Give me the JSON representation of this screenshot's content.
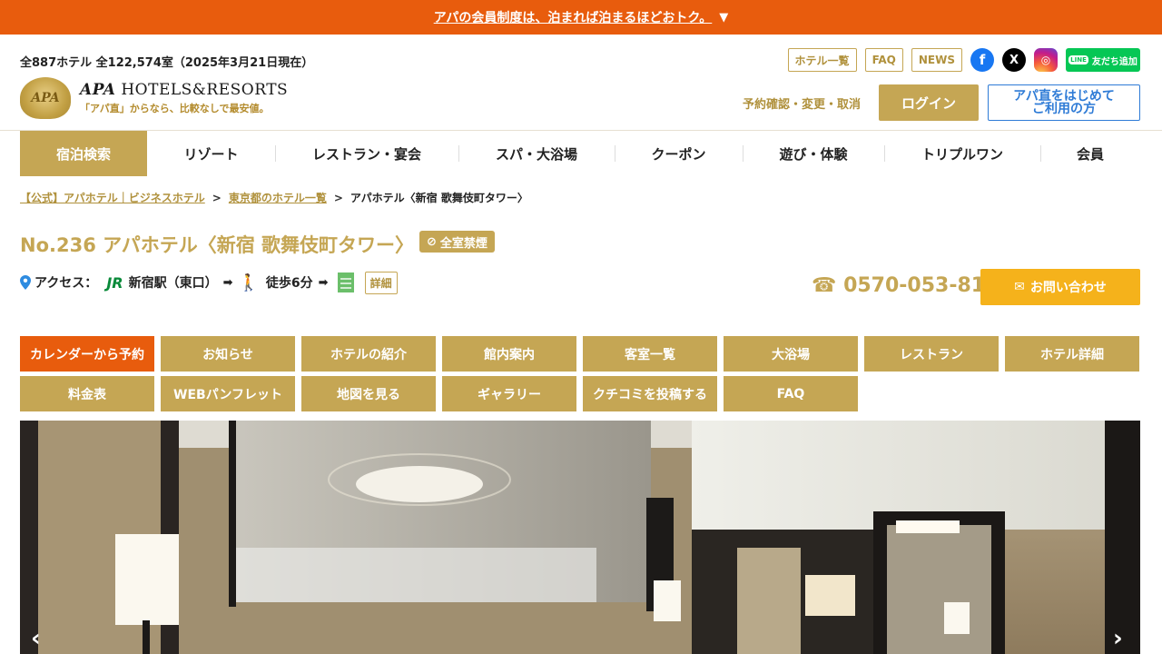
{
  "banner": {
    "text": "アパの会員制度は、泊まれば泊まるほどおトク。",
    "icon": "triangle-down-icon"
  },
  "header": {
    "stats": "全887ホテル 全122,574室（2025年3月21日現在）",
    "logo": {
      "emblem": "APA",
      "brand_bold": "APA",
      "brand_rest": " HOTELS&RESORTS",
      "tagline": "「アパ直」からなら、比較なしで最安値。"
    },
    "links": [
      "ホテル一覧",
      "FAQ",
      "NEWS"
    ],
    "sns": {
      "facebook": "f",
      "x": "X",
      "instagram": "◎",
      "line": "友だち追加",
      "line_bubble": "LINE"
    },
    "reservation_link": "予約確認・変更・取消",
    "login": "ログイン",
    "first_time_line1": "アパ直をはじめて",
    "first_time_line2": "ご利用の方"
  },
  "global_nav": [
    {
      "label": "宿泊検索",
      "active": true
    },
    {
      "label": "リゾート"
    },
    {
      "label": "レストラン・宴会"
    },
    {
      "label": "スパ・大浴場"
    },
    {
      "label": "クーポン"
    },
    {
      "label": "遊び・体験"
    },
    {
      "label": "トリプルワン"
    },
    {
      "label": "会員"
    }
  ],
  "breadcrumb": {
    "home": "【公式】アパホテル｜ビジネスホテル",
    "area": "東京都のホテル一覧",
    "current": "アパホテル〈新宿 歌舞伎町タワー〉",
    "sep": ">"
  },
  "hotel": {
    "title": "No.236 アパホテル〈新宿 歌舞伎町タワー〉",
    "no_smoking": "全室禁煙",
    "access_label": "アクセス：",
    "jr": "JR",
    "station": "新宿駅（東口）",
    "arrow": "➡",
    "walk": "徒歩6分",
    "detail": "詳細",
    "phone": "☎ 0570-053-811",
    "contact": "お問い合わせ",
    "contact_icon": "✉"
  },
  "tabs": [
    {
      "label": "カレンダーから予約",
      "highlight": true
    },
    {
      "label": "お知らせ"
    },
    {
      "label": "ホテルの紹介"
    },
    {
      "label": "館内案内"
    },
    {
      "label": "客室一覧"
    },
    {
      "label": "大浴場"
    },
    {
      "label": "レストラン"
    },
    {
      "label": "ホテル詳細"
    },
    {
      "label": "料金表"
    },
    {
      "label": "WEBパンフレット"
    },
    {
      "label": "地図を見る"
    },
    {
      "label": "ギャラリー"
    },
    {
      "label": "クチコミを投稿する"
    },
    {
      "label": "FAQ"
    }
  ],
  "carousel": {
    "prev": "‹",
    "next": "›"
  },
  "colors": {
    "gold": "#c5a654",
    "orange": "#e85c0d",
    "yellow": "#f5b21b"
  }
}
